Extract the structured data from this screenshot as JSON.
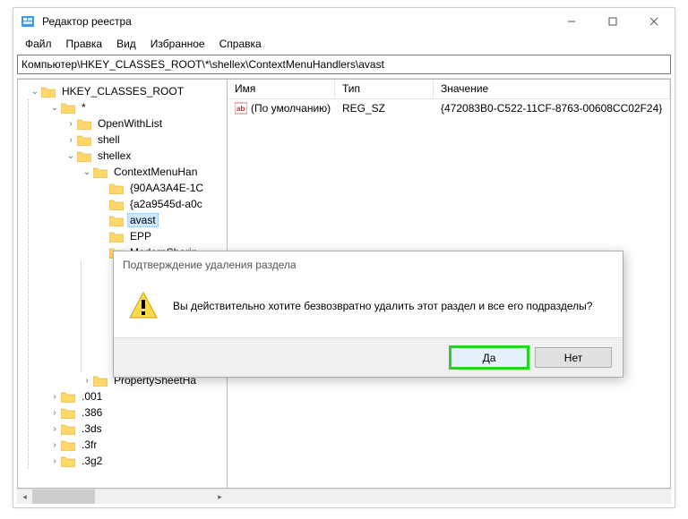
{
  "window": {
    "title": "Редактор реестра"
  },
  "menu": {
    "file": "Файл",
    "edit": "Правка",
    "view": "Вид",
    "favorites": "Избранное",
    "help": "Справка"
  },
  "address": "Компьютер\\HKEY_CLASSES_ROOT\\*\\shellex\\ContextMenuHandlers\\avast",
  "tree": {
    "root": "HKEY_CLASSES_ROOT",
    "star": "*",
    "openwith": "OpenWithList",
    "shell": "shell",
    "shellex": "shellex",
    "cmh": "ContextMenuHan",
    "cmh_items": {
      "i0": "{90AA3A4E-1C",
      "i1": "{a2a9545d-a0c",
      "i2": "avast",
      "i3": "EPP",
      "i4": "ModernSharin"
    },
    "psh": "PropertySheetHa",
    "ext": {
      "e0": ".001",
      "e1": ".386",
      "e2": ".3ds",
      "e3": ".3fr",
      "e4": ".3g2"
    }
  },
  "list": {
    "headers": {
      "name": "Имя",
      "type": "Тип",
      "value": "Значение"
    },
    "row": {
      "name": "(По умолчанию)",
      "type": "REG_SZ",
      "value": "{472083B0-C522-11CF-8763-00608CC02F24}"
    }
  },
  "dialog": {
    "title": "Подтверждение удаления раздела",
    "message": "Вы действительно хотите безвозвратно удалить этот раздел и все его подразделы?",
    "yes": "Да",
    "no": "Нет"
  }
}
